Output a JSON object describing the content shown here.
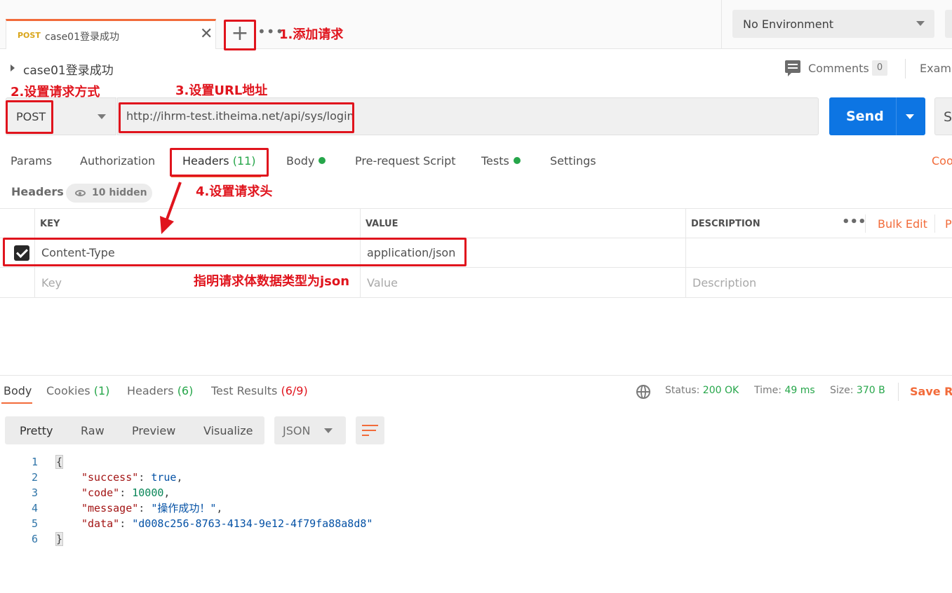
{
  "tab": {
    "method": "POST",
    "name": "case01登录成功",
    "close": "✕",
    "new": "+",
    "more": "•••"
  },
  "environment": {
    "label": "No Environment"
  },
  "request": {
    "title": "case01登录成功",
    "comments_label": "Comments",
    "comments_count": "0",
    "examples_label": "Examp",
    "method": "POST",
    "url": "http://ihrm-test.itheima.net/api/sys/login",
    "send_label": "Send",
    "save_label": "Sa"
  },
  "req_tabs": {
    "params": "Params",
    "authorization": "Authorization",
    "headers": "Headers",
    "headers_count": "(11)",
    "body": "Body",
    "pre_request": "Pre-request Script",
    "tests": "Tests",
    "settings": "Settings",
    "code": "Coo"
  },
  "headers_section": {
    "title": "Headers",
    "hidden": "10 hidden"
  },
  "headers_table": {
    "columns": [
      "KEY",
      "VALUE",
      "DESCRIPTION"
    ],
    "more": "•••",
    "bulk_edit": "Bulk Edit",
    "presets": "P",
    "rows": [
      {
        "key": "Content-Type",
        "value": "application/json",
        "checked": true
      }
    ],
    "placeholders": {
      "key": "Key",
      "value": "Value",
      "description": "Description"
    }
  },
  "annotations": {
    "a1": "1.添加请求",
    "a2": "2.设置请求方式",
    "a3": "3.设置URL地址",
    "a4": "4.设置请求头",
    "a5": "指明请求体数据类型为json"
  },
  "response": {
    "tabs": {
      "body": "Body",
      "cookies": "Cookies",
      "cookies_count": "(1)",
      "headers": "Headers",
      "headers_count": "(6)",
      "test_results": "Test Results",
      "test_results_count": "(6/9)"
    },
    "status_label": "Status:",
    "status_value": "200 OK",
    "time_label": "Time:",
    "time_value": "49 ms",
    "size_label": "Size:",
    "size_value": "370 B",
    "save_response": "Save Re",
    "view_tabs": [
      "Pretty",
      "Raw",
      "Preview",
      "Visualize"
    ],
    "format": "JSON",
    "lines": [
      "1",
      "2",
      "3",
      "4",
      "5",
      "6"
    ],
    "json": {
      "open": "{",
      "k_success": "\"success\"",
      "v_success": "true",
      "k_code": "\"code\"",
      "v_code": "10000",
      "k_message": "\"message\"",
      "v_message": "\"操作成功！\"",
      "k_data": "\"data\"",
      "v_data": "\"d008c256-8763-4134-9e12-4f79fa88a8d8\"",
      "close": "}"
    }
  },
  "colors": {
    "accent": "#f26b3a",
    "send": "#0d75e3",
    "annotation": "#e0141d",
    "ok": "#26a64a"
  }
}
